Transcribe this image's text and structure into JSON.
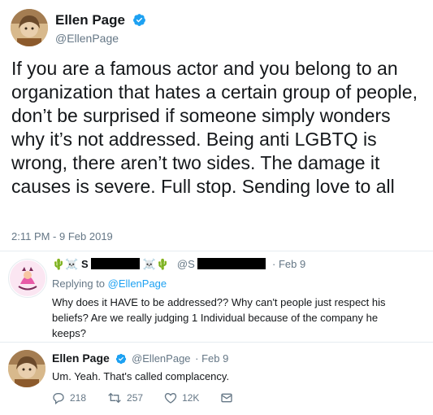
{
  "main_tweet": {
    "author_name": "Ellen Page",
    "handle": "@EllenPage",
    "text": "If you are a famous actor and you belong to an organization that hates a certain group of people, don’t be surprised if someone simply wonders why it’s not addressed. Being anti LGBTQ is wrong, there aren’t two sides. The damage it causes is severe. Full stop. Sending love to all",
    "timestamp": "2:11 PM - 9 Feb 2019"
  },
  "reply_tweet": {
    "name_prefix": "🌵☠️ S",
    "name_suffix": "☠️🌵",
    "handle_prefix": "@S",
    "date": "· Feb 9",
    "replying_label": "Replying to",
    "replying_to": "@EllenPage",
    "text": "Why does it HAVE to be addressed?? Why can't people just respect his beliefs? Are we really judging 1 Individual because of the company he keeps?"
  },
  "ellen_reply": {
    "author_name": "Ellen Page",
    "handle": "@EllenPage",
    "date": "· Feb 9",
    "text": "Um. Yeah. That's called complacency.",
    "replies": "218",
    "retweets": "257",
    "likes": "12K"
  },
  "icons": {
    "verified": "verified-badge-icon",
    "reply": "reply-icon",
    "retweet": "retweet-icon",
    "like": "heart-icon",
    "dm": "envelope-icon"
  },
  "colors": {
    "accent": "#1da1f2",
    "muted": "#657786",
    "text": "#14171a"
  }
}
